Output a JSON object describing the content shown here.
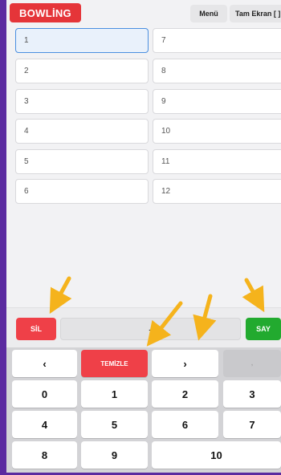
{
  "header": {
    "brand_label": "BOWLİNG",
    "menu_label": "Menü",
    "fullscreen_label": "Tam Ekran [ ]"
  },
  "players": {
    "left": [
      "1",
      "2",
      "3",
      "4",
      "5",
      "6"
    ],
    "right": [
      "7",
      "8",
      "9",
      "10",
      "11",
      "12"
    ]
  },
  "input_bar": {
    "delete_label": "SİL",
    "entry_value": "-",
    "count_label": "SAY"
  },
  "keypad": {
    "row1": {
      "prev": "‹",
      "clear": "TEMİZLE",
      "next": "›",
      "blank": ","
    },
    "row2": [
      "0",
      "1",
      "2",
      "3"
    ],
    "row3": [
      "4",
      "5",
      "6",
      "7"
    ],
    "row4": [
      "8",
      "9",
      "10"
    ]
  },
  "colors": {
    "brand": "#e53539",
    "delete": "#ef4048",
    "count": "#22aa2f",
    "active_border": "#4a8fe0",
    "annotation_arrow": "#f5b31c",
    "frame": "#5b2aa0"
  }
}
